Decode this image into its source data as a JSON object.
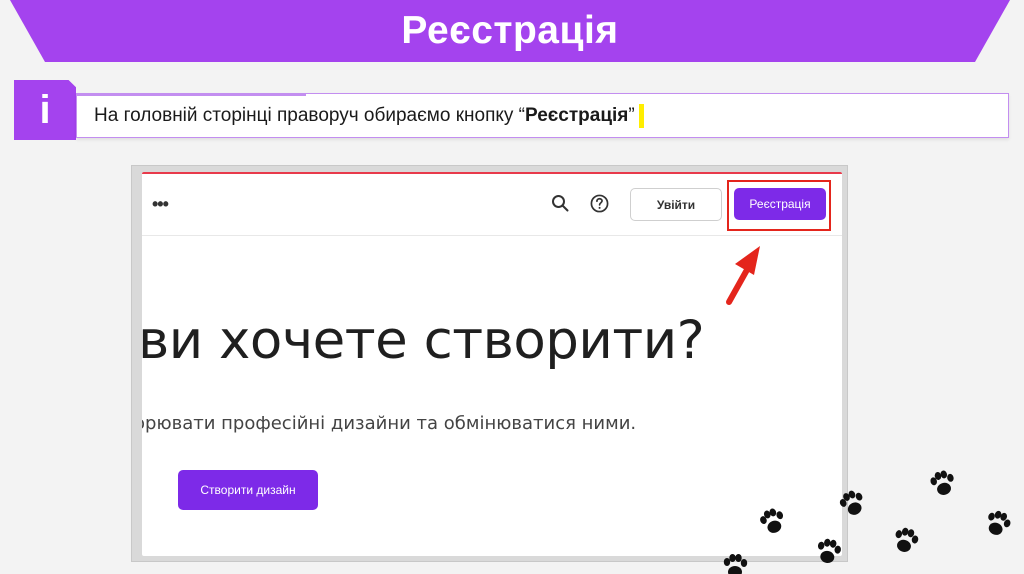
{
  "slide": {
    "title": "Реєстрація",
    "badge": "i",
    "instruction": {
      "prefix": "На головній сторінці праворуч обираємо кнопку “",
      "bold": "Реєстрація",
      "suffix": "”"
    }
  },
  "screenshot": {
    "menu_icon": "more-icon",
    "search_icon": "search-icon",
    "help_icon": "help-icon",
    "login_label": "Увійти",
    "register_label": "Реєстрація",
    "headline": "ви хочете створити?",
    "subline": "орювати професійні дизайни та обмінюватися ними.",
    "create_design_label": "Створити дизайн"
  },
  "colors": {
    "accent": "#a443ee",
    "button_purple": "#7d2ae8",
    "highlight_red": "#e4251c",
    "marker_yellow": "#ffee00"
  }
}
